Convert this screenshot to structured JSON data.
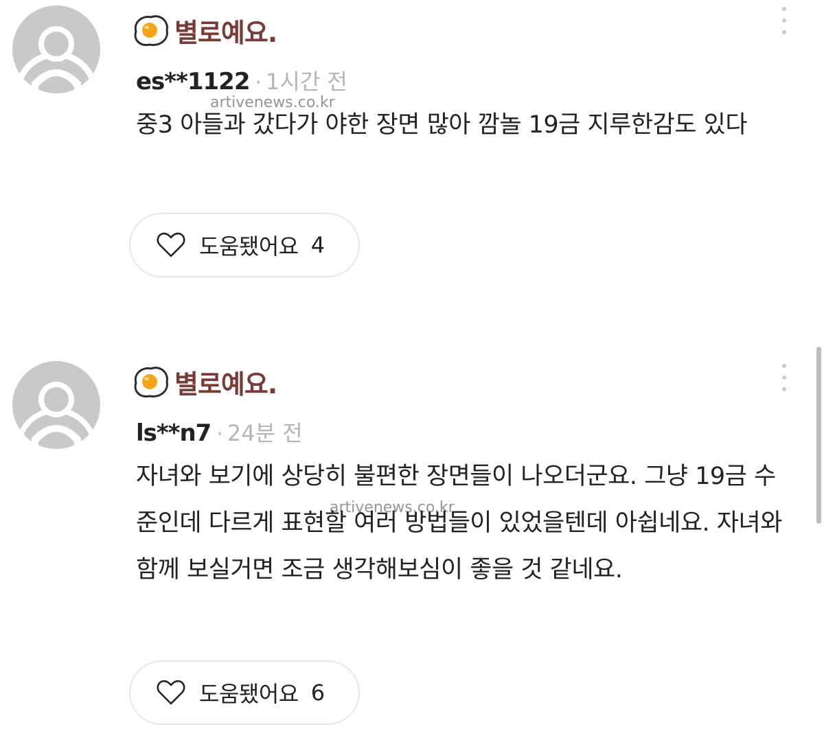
{
  "watermark": "artivenews.co.kr",
  "colors": {
    "rating_text": "#7a3a35",
    "egg_white": "#ffffff",
    "egg_yolk": "#f7a21b",
    "muted_text": "#b5b5b5",
    "avatar_bg": "#c9c9c9",
    "button_border": "#e6e6e6"
  },
  "reviews": [
    {
      "rating_icon": "fried-egg-icon",
      "rating_label": "별로예요.",
      "username": "es**1122",
      "separator": "·",
      "time": "1시간 전",
      "text": "중3 아들과 갔다가 야한 장면 많아 깜놀 19금 지루한감도 있다",
      "helpful_label": "도움됐어요",
      "helpful_count": "4"
    },
    {
      "rating_icon": "fried-egg-icon",
      "rating_label": "별로예요.",
      "username": "ls**n7",
      "separator": "·",
      "time": "24분 전",
      "text": "자녀와 보기에 상당히 불편한 장면들이 나오더군요. 그냥 19금 수준인데 다르게 표현할 여러 방법들이 있었을텐데 아쉽네요. 자녀와 함께 보실거면 조금 생각해보심이 좋을 것 같네요.",
      "helpful_label": "도움됐어요",
      "helpful_count": "6"
    }
  ]
}
